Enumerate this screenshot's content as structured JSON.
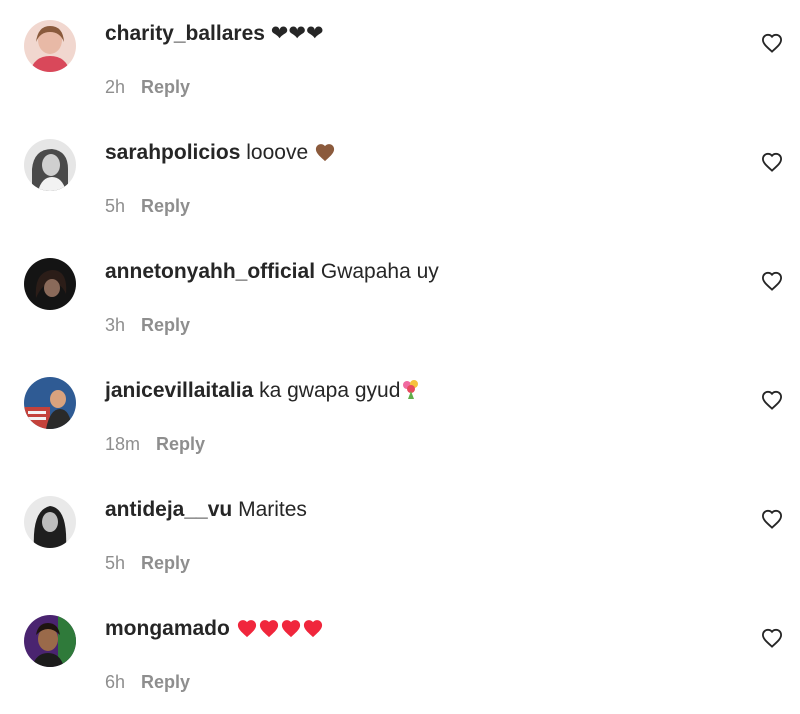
{
  "comments": [
    {
      "username": "charity_ballares",
      "text": "❤❤❤",
      "time": "2h",
      "reply_label": "Reply",
      "like_icon": "heart-outline-icon",
      "avatar_colors": [
        "#e8a7a0",
        "#c45a5a"
      ]
    },
    {
      "username": "sarahpolicios",
      "text": "looove",
      "emoji": "brown-heart",
      "time": "5h",
      "reply_label": "Reply",
      "like_icon": "heart-outline-icon",
      "avatar_colors": [
        "#d9d9d9",
        "#555555"
      ]
    },
    {
      "username": "annetonyahh_official",
      "text": "Gwapaha uy",
      "time": "3h",
      "reply_label": "Reply",
      "like_icon": "heart-outline-icon",
      "avatar_colors": [
        "#1a1a1a",
        "#6b4a3a"
      ]
    },
    {
      "username": "janicevillaitalia",
      "text": "ka gwapa gyud",
      "emoji": "bouquet",
      "time": "18m",
      "reply_label": "Reply",
      "like_icon": "heart-outline-icon",
      "avatar_colors": [
        "#3b6fb5",
        "#c4423b"
      ]
    },
    {
      "username": "antideja__vu",
      "text": "Marites",
      "time": "5h",
      "reply_label": "Reply",
      "like_icon": "heart-outline-icon",
      "avatar_colors": [
        "#2a2a2a",
        "#bdbdbd"
      ]
    },
    {
      "username": "mongamado",
      "text": "",
      "emoji": "red-hearts",
      "time": "6h",
      "reply_label": "Reply",
      "like_icon": "heart-outline-icon",
      "avatar_colors": [
        "#5a2a8a",
        "#3a7a3a"
      ]
    }
  ],
  "colors": {
    "text": "#262626",
    "meta": "#8e8e8e",
    "red_heart": "#f0263c",
    "brown_heart": "#8b5a3c"
  }
}
